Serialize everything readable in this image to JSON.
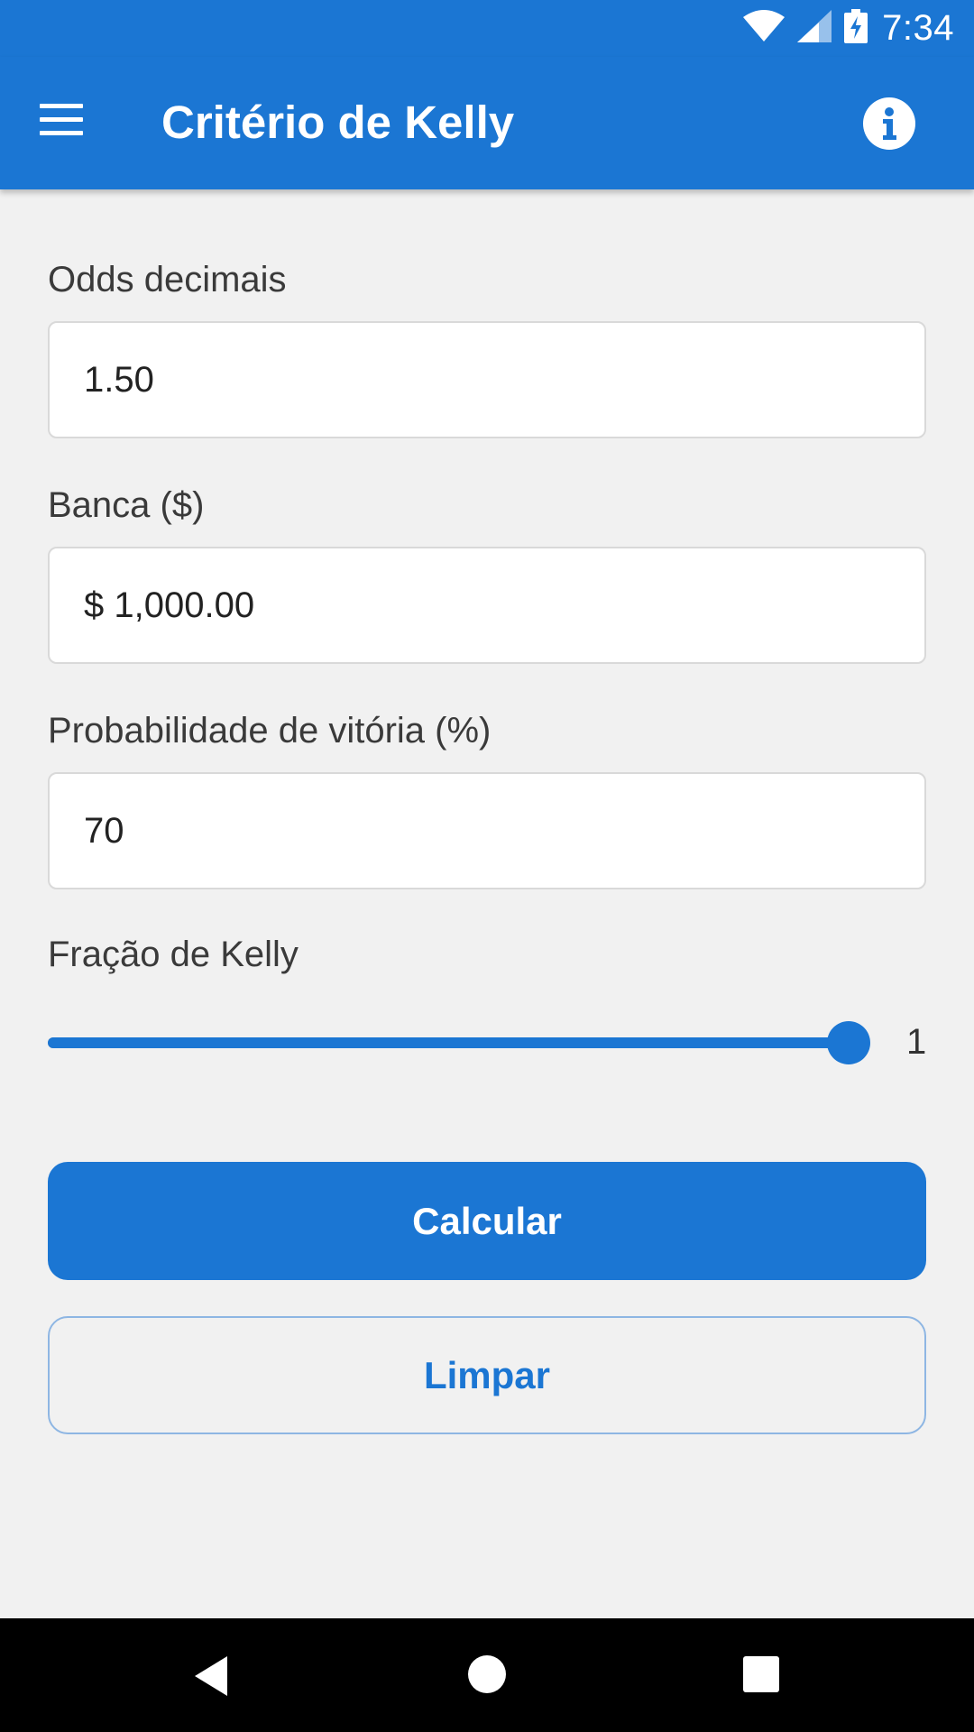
{
  "status_bar": {
    "time": "7:34",
    "icons": [
      "wifi-icon",
      "signal-icon",
      "battery-charging-icon"
    ]
  },
  "app_bar": {
    "title": "Critério de Kelly",
    "menu_icon": "hamburger-menu-icon",
    "info_icon": "info-icon"
  },
  "form": {
    "odds": {
      "label": "Odds decimais",
      "value": "1.50"
    },
    "bankroll": {
      "label": "Banca ($)",
      "value": "$ 1,000.00"
    },
    "probability": {
      "label": "Probabilidade de vitória (%)",
      "value": "70"
    },
    "kelly_fraction": {
      "label": "Fração de Kelly",
      "value": "1",
      "min": 0,
      "max": 1
    }
  },
  "buttons": {
    "calculate": "Calcular",
    "clear": "Limpar"
  },
  "nav_bar": {
    "icons": [
      "back-icon",
      "home-icon",
      "recents-icon"
    ]
  },
  "colors": {
    "primary": "#1b76d3",
    "background": "#f1f1f1",
    "outline": "#8eb6e3"
  }
}
